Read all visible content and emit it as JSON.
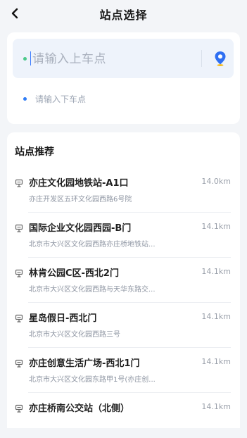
{
  "header": {
    "title": "站点选择"
  },
  "search": {
    "pickup_placeholder": "请输入上车点",
    "dropoff_placeholder": "请输入下车点"
  },
  "recommend": {
    "title": "站点推荐",
    "stations": [
      {
        "name": "亦庄文化园地铁站-A1口",
        "address": "亦庄开发区五环文化园西路6号院",
        "distance": "14.0km"
      },
      {
        "name": "国际企业文化园西园-B门",
        "address": "北京市大兴区文化园西路亦庄桥地铁站...",
        "distance": "14.1km"
      },
      {
        "name": "林肯公园C区-西北2门",
        "address": "北京市大兴区文化园西路与天华东路交...",
        "distance": "14.1km"
      },
      {
        "name": "星岛假日-西北门",
        "address": "北京市大兴区文化园西路三号",
        "distance": "14.1km"
      },
      {
        "name": "亦庄创意生活广场-西北1门",
        "address": "北京市大兴区文化园东路甲1号(亦庄创...",
        "distance": "14.1km"
      },
      {
        "name": "亦庄桥南公交站（北侧）",
        "address": "",
        "distance": "14.1km"
      }
    ]
  },
  "icons": {
    "back": "chevron-left-icon",
    "location": "map-pin-icon",
    "station": "bus-stop-icon"
  },
  "colors": {
    "background": "#f3f5f8",
    "pickup_field": "#eef3fb",
    "pickup_dot": "#4bc98a",
    "dropoff_dot": "#2f7df6",
    "accent": "#3a7bff"
  }
}
